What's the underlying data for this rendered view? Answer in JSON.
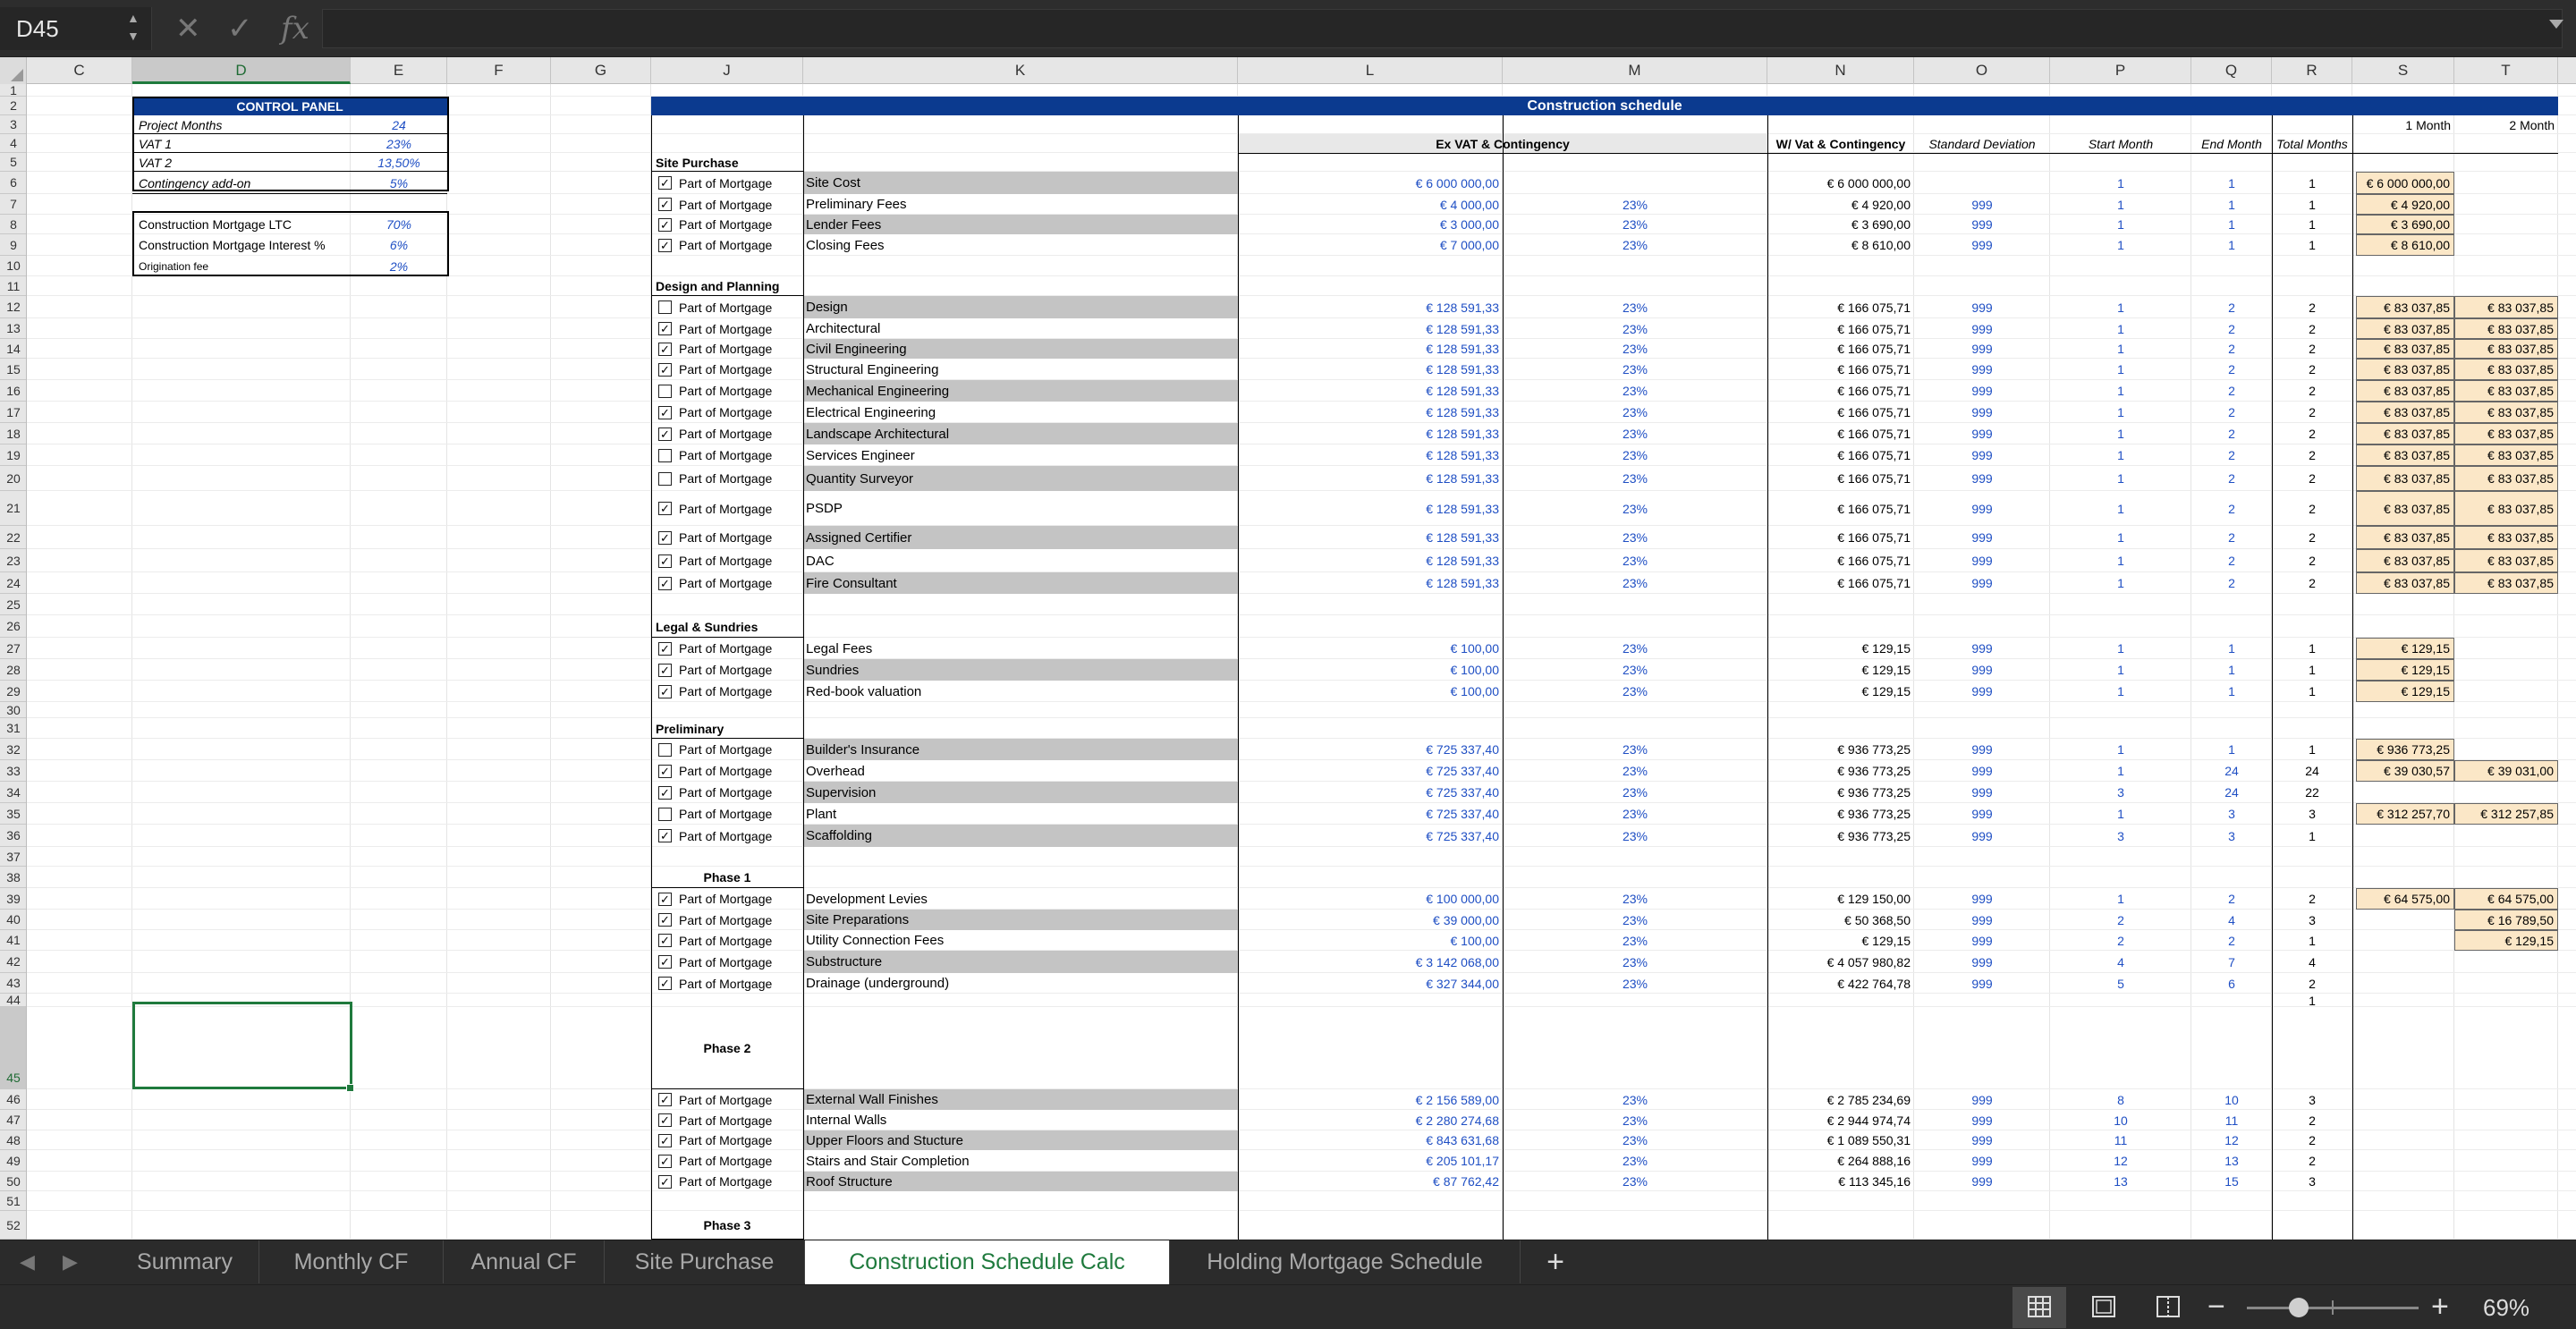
{
  "formula_bar": {
    "name_box": "D45",
    "cancel_icon": "x-icon",
    "confirm_icon": "checkmark-icon",
    "fx_label": "fx",
    "formula_value": ""
  },
  "columns": [
    "C",
    "D",
    "E",
    "F",
    "G",
    "J",
    "K",
    "L",
    "M",
    "N",
    "O",
    "P",
    "Q",
    "R",
    "S",
    "T"
  ],
  "selected_column": "D",
  "selected_row": "45",
  "control_panel": {
    "title": "CONTROL PANEL",
    "rows": [
      {
        "label": "Project Months",
        "value": "24"
      },
      {
        "label": "VAT 1",
        "value": "23%"
      },
      {
        "label": "VAT 2",
        "value": "13,50%"
      },
      {
        "label": "Contingency add-on",
        "value": "5%"
      }
    ],
    "mortgage": [
      {
        "label": "Construction Mortgage LTC",
        "value": "70%"
      },
      {
        "label": "Construction Mortgage Interest %",
        "value": "6%"
      },
      {
        "label": "Origination fee",
        "value": "2%"
      }
    ]
  },
  "schedule": {
    "title": "Construction schedule",
    "headers": {
      "ex_vat": "Ex VAT & Contingency",
      "w_vat": "W/ Vat & Contingency",
      "std_dev": "Standard Deviation",
      "start_month": "Start Month",
      "end_month": "End Month",
      "total_months": "Total Months",
      "month1": "1 Month",
      "month2": "2 Month"
    },
    "checkbox_label": "Part of Mortgage",
    "sections": [
      {
        "title": "Site Purchase",
        "rows": [
          {
            "row": 6,
            "checked": true,
            "name": "Site Cost",
            "ex": "€ 6 000 000,00",
            "vat": "",
            "w": "€ 6 000 000,00",
            "sd": "",
            "s": "1",
            "e": "1",
            "t": "1",
            "m1": "€ 6 000 000,00",
            "m2": ""
          },
          {
            "row": 7,
            "checked": true,
            "name": "Preliminary Fees",
            "ex": "€ 4 000,00",
            "vat": "23%",
            "w": "€ 4 920,00",
            "sd": "999",
            "s": "1",
            "e": "1",
            "t": "1",
            "m1": "€ 4 920,00",
            "m2": ""
          },
          {
            "row": 8,
            "checked": true,
            "name": "Lender Fees",
            "ex": "€ 3 000,00",
            "vat": "23%",
            "w": "€ 3 690,00",
            "sd": "999",
            "s": "1",
            "e": "1",
            "t": "1",
            "m1": "€ 3 690,00",
            "m2": ""
          },
          {
            "row": 9,
            "checked": true,
            "name": "Closing Fees",
            "ex": "€ 7 000,00",
            "vat": "23%",
            "w": "€ 8 610,00",
            "sd": "999",
            "s": "1",
            "e": "1",
            "t": "1",
            "m1": "€ 8 610,00",
            "m2": ""
          }
        ]
      },
      {
        "title": "Design and Planning",
        "rows": [
          {
            "row": 12,
            "checked": false,
            "name": "Design",
            "ex": "€ 128 591,33",
            "vat": "23%",
            "w": "€ 166 075,71",
            "sd": "999",
            "s": "1",
            "e": "2",
            "t": "2",
            "m1": "€ 83 037,85",
            "m2": "€ 83 037,85"
          },
          {
            "row": 13,
            "checked": true,
            "name": "Architectural",
            "ex": "€ 128 591,33",
            "vat": "23%",
            "w": "€ 166 075,71",
            "sd": "999",
            "s": "1",
            "e": "2",
            "t": "2",
            "m1": "€ 83 037,85",
            "m2": "€ 83 037,85"
          },
          {
            "row": 14,
            "checked": true,
            "name": "Civil Engineering",
            "ex": "€ 128 591,33",
            "vat": "23%",
            "w": "€ 166 075,71",
            "sd": "999",
            "s": "1",
            "e": "2",
            "t": "2",
            "m1": "€ 83 037,85",
            "m2": "€ 83 037,85"
          },
          {
            "row": 15,
            "checked": true,
            "name": "Structural Engineering",
            "ex": "€ 128 591,33",
            "vat": "23%",
            "w": "€ 166 075,71",
            "sd": "999",
            "s": "1",
            "e": "2",
            "t": "2",
            "m1": "€ 83 037,85",
            "m2": "€ 83 037,85"
          },
          {
            "row": 16,
            "checked": false,
            "name": "Mechanical Engineering",
            "ex": "€ 128 591,33",
            "vat": "23%",
            "w": "€ 166 075,71",
            "sd": "999",
            "s": "1",
            "e": "2",
            "t": "2",
            "m1": "€ 83 037,85",
            "m2": "€ 83 037,85"
          },
          {
            "row": 17,
            "checked": true,
            "name": "Electrical Engineering",
            "ex": "€ 128 591,33",
            "vat": "23%",
            "w": "€ 166 075,71",
            "sd": "999",
            "s": "1",
            "e": "2",
            "t": "2",
            "m1": "€ 83 037,85",
            "m2": "€ 83 037,85"
          },
          {
            "row": 18,
            "checked": true,
            "name": "Landscape Architectural",
            "ex": "€ 128 591,33",
            "vat": "23%",
            "w": "€ 166 075,71",
            "sd": "999",
            "s": "1",
            "e": "2",
            "t": "2",
            "m1": "€ 83 037,85",
            "m2": "€ 83 037,85"
          },
          {
            "row": 19,
            "checked": false,
            "name": "Services Engineer",
            "ex": "€ 128 591,33",
            "vat": "23%",
            "w": "€ 166 075,71",
            "sd": "999",
            "s": "1",
            "e": "2",
            "t": "2",
            "m1": "€ 83 037,85",
            "m2": "€ 83 037,85"
          },
          {
            "row": 20,
            "checked": false,
            "name": "Quantity Surveyor",
            "ex": "€ 128 591,33",
            "vat": "23%",
            "w": "€ 166 075,71",
            "sd": "999",
            "s": "1",
            "e": "2",
            "t": "2",
            "m1": "€ 83 037,85",
            "m2": "€ 83 037,85"
          },
          {
            "row": 21,
            "checked": true,
            "name": "PSDP",
            "ex": "€ 128 591,33",
            "vat": "23%",
            "w": "€ 166 075,71",
            "sd": "999",
            "s": "1",
            "e": "2",
            "t": "2",
            "m1": "€ 83 037,85",
            "m2": "€ 83 037,85"
          },
          {
            "row": 22,
            "checked": true,
            "name": "Assigned Certifier",
            "ex": "€ 128 591,33",
            "vat": "23%",
            "w": "€ 166 075,71",
            "sd": "999",
            "s": "1",
            "e": "2",
            "t": "2",
            "m1": "€ 83 037,85",
            "m2": "€ 83 037,85"
          },
          {
            "row": 23,
            "checked": true,
            "name": "DAC",
            "ex": "€ 128 591,33",
            "vat": "23%",
            "w": "€ 166 075,71",
            "sd": "999",
            "s": "1",
            "e": "2",
            "t": "2",
            "m1": "€ 83 037,85",
            "m2": "€ 83 037,85"
          },
          {
            "row": 24,
            "checked": true,
            "name": "Fire Consultant",
            "ex": "€ 128 591,33",
            "vat": "23%",
            "w": "€ 166 075,71",
            "sd": "999",
            "s": "1",
            "e": "2",
            "t": "2",
            "m1": "€ 83 037,85",
            "m2": "€ 83 037,85"
          }
        ]
      },
      {
        "title": "Legal & Sundries",
        "rows": [
          {
            "row": 27,
            "checked": true,
            "name": "Legal Fees",
            "ex": "€ 100,00",
            "vat": "23%",
            "w": "€ 129,15",
            "sd": "999",
            "s": "1",
            "e": "1",
            "t": "1",
            "m1": "€ 129,15",
            "m2": ""
          },
          {
            "row": 28,
            "checked": true,
            "name": "Sundries",
            "ex": "€ 100,00",
            "vat": "23%",
            "w": "€ 129,15",
            "sd": "999",
            "s": "1",
            "e": "1",
            "t": "1",
            "m1": "€ 129,15",
            "m2": ""
          },
          {
            "row": 29,
            "checked": true,
            "name": "Red-book valuation",
            "ex": "€ 100,00",
            "vat": "23%",
            "w": "€ 129,15",
            "sd": "999",
            "s": "1",
            "e": "1",
            "t": "1",
            "m1": "€ 129,15",
            "m2": ""
          }
        ]
      },
      {
        "title": "Preliminary",
        "rows": [
          {
            "row": 32,
            "checked": false,
            "name": "Builder's Insurance",
            "ex": "€ 725 337,40",
            "vat": "23%",
            "w": "€ 936 773,25",
            "sd": "999",
            "s": "1",
            "e": "1",
            "t": "1",
            "m1": "€ 936 773,25",
            "m2": ""
          },
          {
            "row": 33,
            "checked": true,
            "name": "Overhead",
            "ex": "€ 725 337,40",
            "vat": "23%",
            "w": "€ 936 773,25",
            "sd": "999",
            "s": "1",
            "e": "24",
            "t": "24",
            "m1": "€ 39 030,57",
            "m2": "€ 39 031,00"
          },
          {
            "row": 34,
            "checked": true,
            "name": "Supervision",
            "ex": "€ 725 337,40",
            "vat": "23%",
            "w": "€ 936 773,25",
            "sd": "999",
            "s": "3",
            "e": "24",
            "t": "22",
            "m1": "",
            "m2": ""
          },
          {
            "row": 35,
            "checked": false,
            "name": "Plant",
            "ex": "€ 725 337,40",
            "vat": "23%",
            "w": "€ 936 773,25",
            "sd": "999",
            "s": "1",
            "e": "3",
            "t": "3",
            "m1": "€ 312 257,70",
            "m2": "€ 312 257,85"
          },
          {
            "row": 36,
            "checked": true,
            "name": "Scaffolding",
            "ex": "€ 725 337,40",
            "vat": "23%",
            "w": "€ 936 773,25",
            "sd": "999",
            "s": "3",
            "e": "3",
            "t": "1",
            "m1": "",
            "m2": ""
          }
        ]
      },
      {
        "title": "Phase 1",
        "rows": [
          {
            "row": 39,
            "checked": true,
            "name": "Development Levies",
            "ex": "€ 100 000,00",
            "vat": "23%",
            "w": "€ 129 150,00",
            "sd": "999",
            "s": "1",
            "e": "2",
            "t": "2",
            "m1": "€ 64 575,00",
            "m2": "€ 64 575,00"
          },
          {
            "row": 40,
            "checked": true,
            "name": "Site Preparations",
            "ex": "€ 39 000,00",
            "vat": "23%",
            "w": "€ 50 368,50",
            "sd": "999",
            "s": "2",
            "e": "4",
            "t": "3",
            "m1": "",
            "m2": "€ 16 789,50"
          },
          {
            "row": 41,
            "checked": true,
            "name": "Utility Connection Fees",
            "ex": "€ 100,00",
            "vat": "23%",
            "w": "€ 129,15",
            "sd": "999",
            "s": "2",
            "e": "2",
            "t": "1",
            "m1": "",
            "m2": "€ 129,15"
          },
          {
            "row": 42,
            "checked": true,
            "name": "Substructure",
            "ex": "€ 3 142 068,00",
            "vat": "23%",
            "w": "€ 4 057 980,82",
            "sd": "999",
            "s": "4",
            "e": "7",
            "t": "4",
            "m1": "",
            "m2": ""
          },
          {
            "row": 43,
            "checked": true,
            "name": "Drainage (underground)",
            "ex": "€ 327 344,00",
            "vat": "23%",
            "w": "€ 422 764,78",
            "sd": "999",
            "s": "5",
            "e": "6",
            "t": "2",
            "m1": "",
            "m2": ""
          }
        ]
      },
      {
        "title": "Phase 2",
        "rows": [
          {
            "row": 46,
            "checked": true,
            "name": "External Wall Finishes",
            "ex": "€ 2 156 589,00",
            "vat": "23%",
            "w": "€ 2 785 234,69",
            "sd": "999",
            "s": "8",
            "e": "10",
            "t": "3",
            "m1": "",
            "m2": ""
          },
          {
            "row": 47,
            "checked": true,
            "name": "Internal Walls",
            "ex": "€ 2 280 274,68",
            "vat": "23%",
            "w": "€ 2 944 974,74",
            "sd": "999",
            "s": "10",
            "e": "11",
            "t": "2",
            "m1": "",
            "m2": ""
          },
          {
            "row": 48,
            "checked": true,
            "name": "Upper Floors and Stucture",
            "ex": "€ 843 631,68",
            "vat": "23%",
            "w": "€ 1 089 550,31",
            "sd": "999",
            "s": "11",
            "e": "12",
            "t": "2",
            "m1": "",
            "m2": ""
          },
          {
            "row": 49,
            "checked": true,
            "name": "Stairs and Stair Completion",
            "ex": "€ 205 101,17",
            "vat": "23%",
            "w": "€ 264 888,16",
            "sd": "999",
            "s": "12",
            "e": "13",
            "t": "2",
            "m1": "",
            "m2": ""
          },
          {
            "row": 50,
            "checked": true,
            "name": "Roof Structure",
            "ex": "€ 87 762,42",
            "vat": "23%",
            "w": "€ 113 345,16",
            "sd": "999",
            "s": "13",
            "e": "15",
            "t": "3",
            "m1": "",
            "m2": ""
          }
        ]
      },
      {
        "title": "Phase 3",
        "rows": []
      }
    ],
    "row44_total": "1"
  },
  "tabs": [
    {
      "label": "Summary",
      "active": false
    },
    {
      "label": "Monthly CF",
      "active": false
    },
    {
      "label": "Annual CF",
      "active": false
    },
    {
      "label": "Site Purchase",
      "active": false
    },
    {
      "label": "Construction Schedule Calc",
      "active": true
    },
    {
      "label": "Holding Mortgage Schedule",
      "active": false
    }
  ],
  "tab_add_label": "+",
  "status": {
    "zoom": "69%",
    "zoom_minus": "−",
    "zoom_plus": "+",
    "zoom_fraction": 0.3,
    "views": [
      "normal-view-icon",
      "page-layout-icon",
      "page-break-icon"
    ]
  }
}
